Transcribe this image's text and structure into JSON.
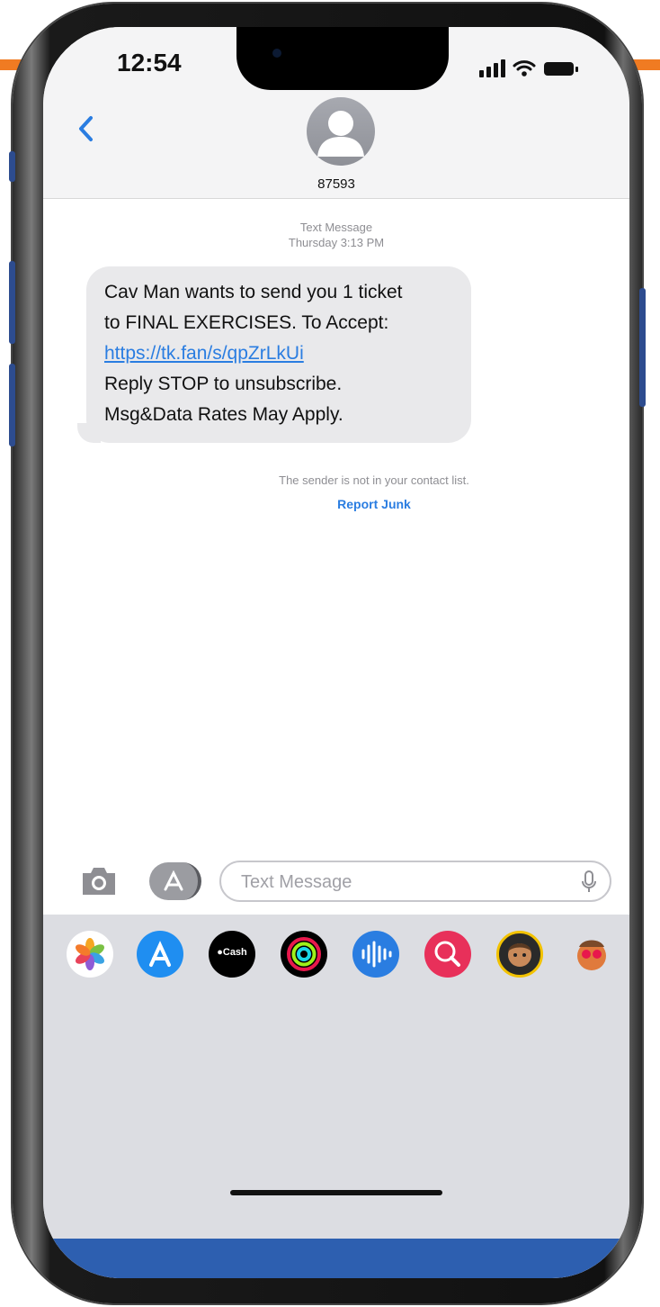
{
  "status_bar": {
    "time": "12:54"
  },
  "header": {
    "contact": "87593"
  },
  "message": {
    "meta_line1": "Text Message",
    "meta_line2": "Thursday 3:13 PM",
    "line1": "Cav Man wants to send you 1 ticket",
    "line2": "to FINAL EXERCISES. To Accept:",
    "link": "https://tk.fan/s/qpZrLkUi",
    "line3": "Reply STOP to unsubscribe.",
    "line4": "Msg&Data Rates May Apply."
  },
  "notice": {
    "text": "The sender is not in your contact list.",
    "report_junk": "Report Junk"
  },
  "composer": {
    "placeholder": "Text Message"
  },
  "app_drawer": {
    "apps": [
      "photos",
      "app-store",
      "apple-cash",
      "activity",
      "audio-messages",
      "web-search",
      "memoji",
      "animoji"
    ],
    "cash_label": "Cash"
  },
  "colors": {
    "accent_blue": "#2a7de1",
    "bubble_gray": "#e9e9eb",
    "orange": "#f07b22"
  }
}
